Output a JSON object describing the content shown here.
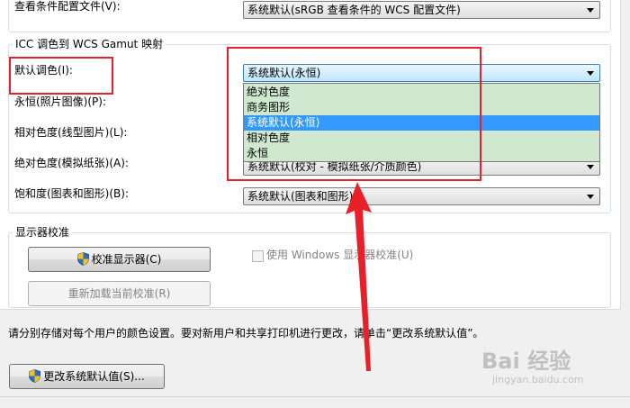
{
  "top_row": {
    "label": "查看条件配置文件(V):",
    "combo_value": "系统默认(sRGB 查看条件的 WCS 配置文件)"
  },
  "gamut_group": {
    "title": "ICC 调色到 WCS Gamut 映射",
    "rows": [
      {
        "label": "默认调色(I):",
        "value": "系统默认(永恒)"
      },
      {
        "label": "永恒(照片图像)(P):",
        "value": ""
      },
      {
        "label": "相对色度(线型图片)(L):",
        "value": ""
      },
      {
        "label": "绝对色度(模拟纸张)(A):",
        "value": "系统默认(校对 - 模拟纸张/介质颜色)"
      },
      {
        "label": "饱和度(图表和图形)(B):",
        "value": "系统默认(图表和图形)"
      }
    ],
    "dropdown_options": [
      "绝对色度",
      "商务图形",
      "系统默认(永恒)",
      "相对色度",
      "永恒"
    ],
    "dropdown_selected_index": 2
  },
  "calibration_group": {
    "title": "显示器校准",
    "calibrate_button": "校准显示器(C)",
    "reload_button": "重新加载当前校准(R)",
    "windows_calibration_checkbox": "使用 Windows 显示器校准(U)",
    "windows_calibration_checked": false
  },
  "footer": {
    "note": "请分别存储对每个用户的颜色设置。要对新用户和共享打印机进行更改，请单击“更改系统默认值”。",
    "change_defaults_button": "更改系统默认值(S)..."
  },
  "watermark": {
    "brand": "Bai 经验",
    "url": "jingyan.baidu.com"
  },
  "colors": {
    "annotation_red": "#e8202a",
    "dropdown_bg": "#cfe8cf",
    "selection_blue": "#3399ff"
  }
}
